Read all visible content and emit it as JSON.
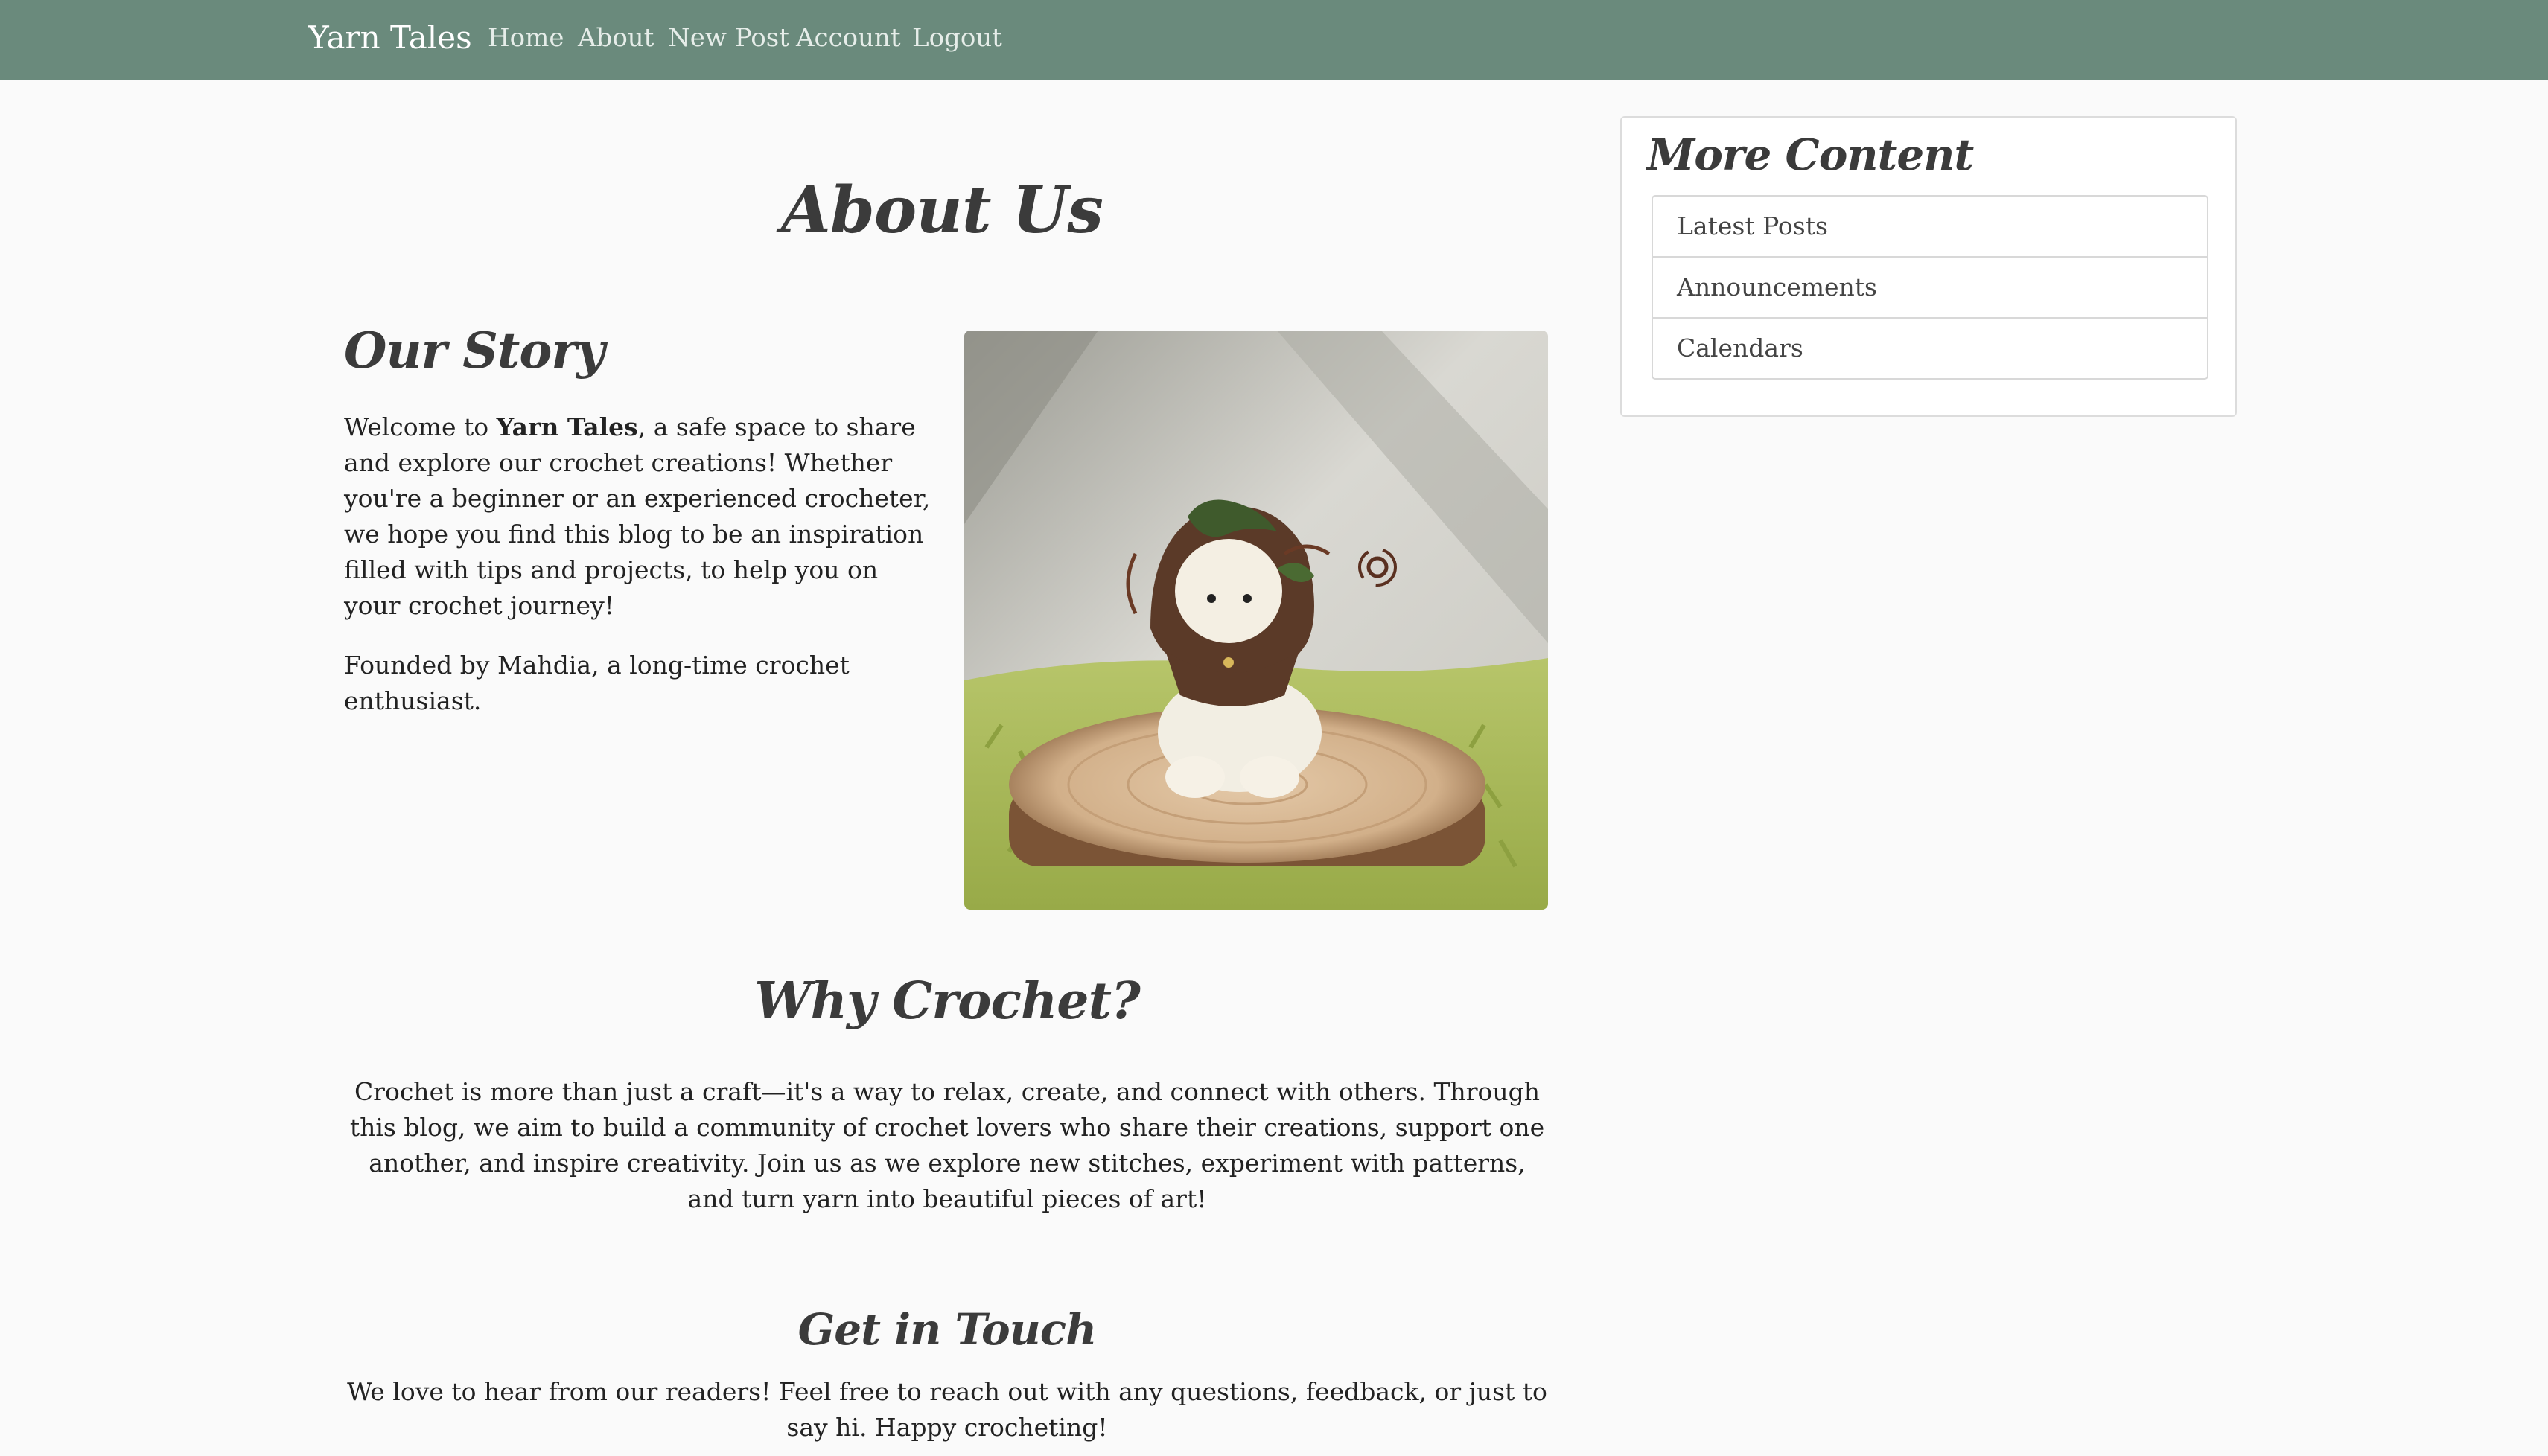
{
  "navbar": {
    "brand": "Yarn Tales",
    "links": [
      "Home",
      "About",
      "New Post",
      "Account",
      "Logout"
    ],
    "background_color": "#6a8a7c"
  },
  "main": {
    "page_title": "About Us",
    "story": {
      "title": "Our Story",
      "intro_before": "Welcome to ",
      "intro_bold": "Yarn Tales",
      "intro_after": ", a safe space to share and explore our crochet creations! Whether you're a beginner or an experienced crocheter, we hope you find this blog to be an inspiration filled with tips and projects, to help you on your crochet journey!",
      "founder": "Founded by Mahdia, a long-time crochet enthusiast.",
      "image_icon": "crochet-doll-photo"
    },
    "why": {
      "title": "Why Crochet?",
      "text": "Crochet is more than just a craft—it's a way to relax, create, and connect with others. Through this blog, we aim to build a community of crochet lovers who share their creations, support one another, and inspire creativity. Join us as we explore new stitches, experiment with patterns, and turn yarn into beautiful pieces of art!"
    },
    "contact": {
      "title": "Get in Touch",
      "text": "We love to hear from our readers! Feel free to reach out with any questions, feedback, or just to say hi. Happy crocheting!"
    }
  },
  "sidebar": {
    "title": "More Content",
    "items": [
      "Latest Posts",
      "Announcements",
      "Calendars"
    ]
  }
}
